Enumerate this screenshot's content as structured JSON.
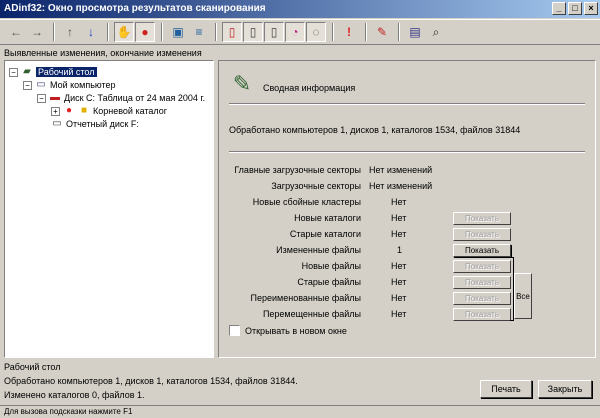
{
  "window": {
    "title": "ADinf32: Окно просмотра результатов сканирования",
    "controls": [
      "_",
      "□",
      "×"
    ]
  },
  "toolbar": {
    "buttons": [
      {
        "name": "back-icon",
        "glyph": "←"
      },
      {
        "name": "forward-icon",
        "glyph": "→"
      },
      {
        "name": "up-icon",
        "glyph": "↑"
      },
      {
        "name": "down-icon",
        "glyph": "↓"
      },
      {
        "name": "hand-icon",
        "glyph": "✋"
      },
      {
        "name": "folder-icon",
        "glyph": "●"
      },
      {
        "name": "document-icon",
        "glyph": "▣"
      },
      {
        "name": "list-icon",
        "glyph": "≡"
      },
      {
        "name": "new-file-icon",
        "glyph": "▯"
      },
      {
        "name": "page-icon",
        "glyph": "▯"
      },
      {
        "name": "copy-icon",
        "glyph": "▯"
      },
      {
        "name": "clock-icon",
        "glyph": "◔"
      },
      {
        "name": "clean-icon",
        "glyph": "◌"
      },
      {
        "name": "alert-icon",
        "glyph": "!"
      },
      {
        "name": "pen-icon",
        "glyph": "✎"
      },
      {
        "name": "calendar-icon",
        "glyph": "▤"
      },
      {
        "name": "search-icon",
        "glyph": "⌕"
      }
    ]
  },
  "left": {
    "label": "Выявленные изменения, окончание изменения"
  },
  "tree": {
    "nodes": [
      {
        "label": "Рабочий стол"
      },
      {
        "label": "Мой компьютер"
      },
      {
        "label": "Диск C: Таблица от 24 мая 2004 г."
      },
      {
        "label": "Корневой каталог"
      },
      {
        "label": "Отчетный диск F:"
      }
    ]
  },
  "panel": {
    "title": "Сводная информация",
    "summary": "Обработано компьютеров 1, дисков 1, каталогов 1534, файлов 31844",
    "rows": [
      {
        "label": "Главные загрузочные секторы",
        "value": "Нет изменений",
        "button": ""
      },
      {
        "label": "Загрузочные секторы",
        "value": "Нет изменений",
        "button": ""
      },
      {
        "label": "Новые сбойные кластеры",
        "value": "Нет",
        "button": ""
      },
      {
        "label": "Новые каталоги",
        "value": "Нет",
        "button": "Показать"
      },
      {
        "label": "Старые каталоги",
        "value": "Нет",
        "button": "Показать"
      },
      {
        "label": "Измененные файлы",
        "value": "1",
        "button": "Показать"
      },
      {
        "label": "Новые файлы",
        "value": "Нет",
        "button": "Показать"
      },
      {
        "label": "Старые файлы",
        "value": "Нет",
        "button": "Показать"
      },
      {
        "label": "Переименованные файлы",
        "value": "Нет",
        "button": "Показать"
      },
      {
        "label": "Перемещенные файлы",
        "value": "Нет",
        "button": "Показать"
      }
    ],
    "all_button": "Все",
    "checkbox_label": "Открывать в новом окне"
  },
  "status": {
    "location": "Рабочий стол",
    "line1": "Обработано компьютеров 1, дисков 1, каталогов 1534, файлов 31844.",
    "line2": "Изменено каталогов 0, файлов 1."
  },
  "buttons": {
    "print": "Печать",
    "close": "Закрыть"
  },
  "statusbar": {
    "text": "Для вызова подсказки нажмите F1"
  }
}
